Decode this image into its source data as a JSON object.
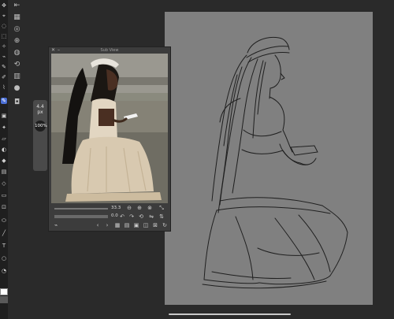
{
  "brush_panel": {
    "size": "4.4",
    "size_unit": "px",
    "opacity": "100",
    "opacity_unit": "%"
  },
  "reference_window": {
    "title": "Sub View",
    "zoom": "33.3",
    "rotation": "0.0"
  },
  "colors": {
    "canvas": "#808080",
    "accent": "#4b6fd6",
    "panel": "#3c3c3c",
    "background": "#2a2a2a"
  }
}
